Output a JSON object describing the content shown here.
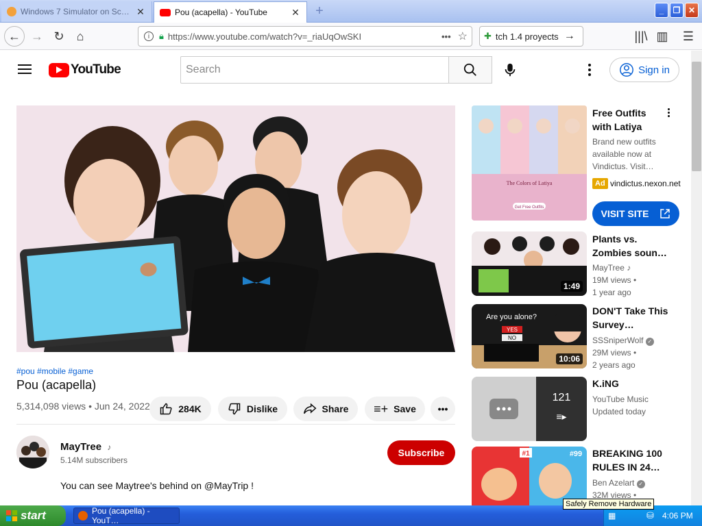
{
  "browser": {
    "tabs": [
      {
        "title": "Windows 7 Simulator on Scratch",
        "active": false
      },
      {
        "title": "Pou (acapella) - YouTube",
        "active": true
      }
    ],
    "url": "https://www.youtube.com/watch?v=_riaUqOwSKI",
    "bookmark_label": "tch 1.4 proyects"
  },
  "youtube": {
    "logo_text": "YouTube",
    "search_placeholder": "Search",
    "signin_label": "Sign in"
  },
  "video": {
    "hashtags": "#pou #mobile #game",
    "title": "Pou (acapella)",
    "views_date": "5,314,098 views • Jun 24, 2022",
    "likes": "284K",
    "dislike_label": "Dislike",
    "share_label": "Share",
    "save_label": "Save",
    "channel_name": "MayTree",
    "subscribers": "5.14M subscribers",
    "subscribe_label": "Subscribe",
    "description": "You can see Maytree's behind on @MayTrip !"
  },
  "ad": {
    "title": "Free Outfits with Latiya",
    "description": "Brand new outfits available now at Vindictus. Visit…",
    "badge": "Ad",
    "domain": "vindictus.nexon.net",
    "cta": "VISIT SITE",
    "thumb_caption": "The Colors of Latiya",
    "thumb_subcaption": "Get Free Outfits"
  },
  "sidebar": [
    {
      "title": "Plants vs. Zombies soun…",
      "channel": "MayTree",
      "views": "19M views •",
      "age": "1 year ago",
      "duration": "1:49"
    },
    {
      "title": "DON'T Take This Survey…",
      "channel": "SSSniperWolf",
      "views": "29M views •",
      "age": "2 years ago",
      "duration": "10:06",
      "thumb_text": "Are you alone?",
      "yes": "YES",
      "no": "NO"
    },
    {
      "title": "K.iNG",
      "channel": "YouTube Music",
      "views": "Updated today",
      "playlist_count": "121"
    },
    {
      "title": "BREAKING 100 RULES IN 24…",
      "channel": "Ben Azelart",
      "views": "32M views •",
      "badge1": "#1",
      "badge2": "#99"
    }
  ],
  "taskbar": {
    "start_label": "start",
    "task_item": "Pou (acapella) - YouT…",
    "clock": "4:06 PM",
    "tooltip": "Safely Remove Hardware"
  },
  "colors": {
    "youtube_red": "#ff0000",
    "link_blue": "#065fd4",
    "subscribe_red": "#cc0000",
    "xp_taskbar": "#245edb",
    "xp_start": "#3c9a3a"
  }
}
